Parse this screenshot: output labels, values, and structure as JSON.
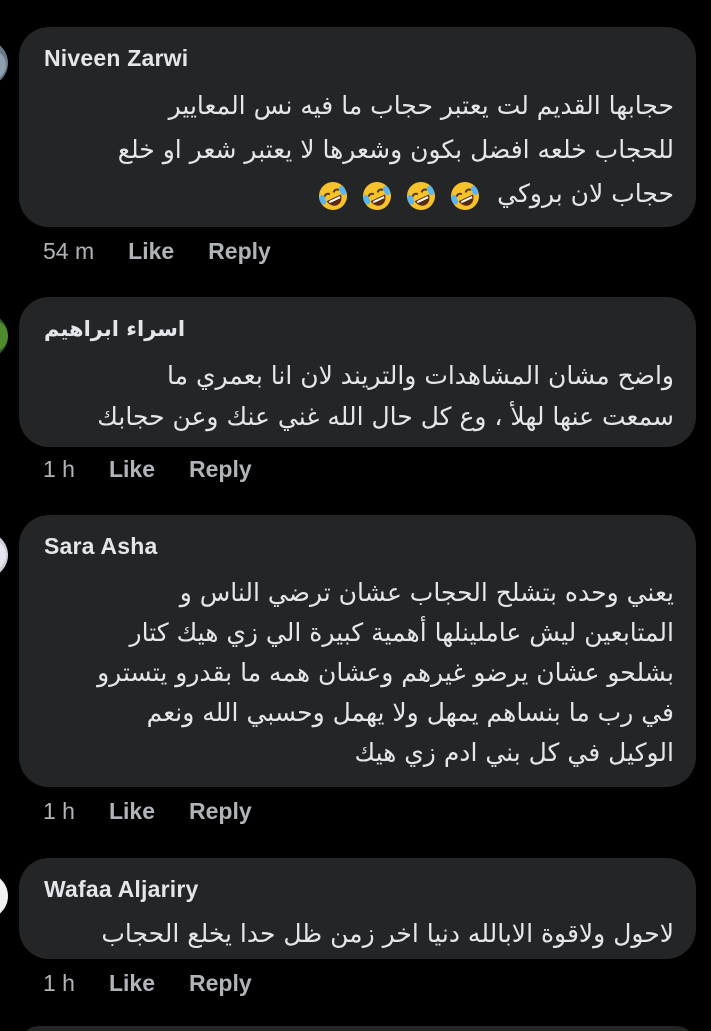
{
  "colors": {
    "background": "#000000",
    "bubble": "#242526",
    "primary_text": "#e4e6eb",
    "secondary_text": "#b0b3b8"
  },
  "comments": [
    {
      "author": "Niveen Zarwi",
      "lines": [
        "حجابها القديم لت يعتبر حجاب ما فيه نس المعايير",
        "للحجاب خلعه افضل بكون وشعرها لا يعتبر شعر او خلع",
        "حجاب لان بروكي"
      ],
      "emoji": "🤣🤣🤣🤣",
      "emoji_icon": "rolling-on-floor-laughing-icon",
      "time": "54 m",
      "like": "Like",
      "reply": "Reply"
    },
    {
      "author": "اسراء ابراهيم",
      "lines": [
        "واضح مشان المشاهدات والتريند لان انا بعمري ما",
        "سمعت عنها لهلأ ، وع كل حال الله غني عنك وعن حجابك"
      ],
      "time": "1 h",
      "like": "Like",
      "reply": "Reply"
    },
    {
      "author": "Sara Asha",
      "lines": [
        "يعني وحده بتشلح الحجاب عشان ترضي الناس و",
        "المتابعين ليش عاملينلها أهمية كبيرة الي زي هيك كتار",
        "بشلحو عشان يرضو غيرهم وعشان همه ما بقدرو يتسترو",
        "في رب ما بنساهم يمهل ولا يهمل وحسبي الله ونعم",
        "الوكيل في كل بني ادم زي هيك"
      ],
      "time": "1 h",
      "like": "Like",
      "reply": "Reply"
    },
    {
      "author": "Wafaa Aljariry",
      "lines": [
        "لاحول ولاقوة الابالله دنيا اخر زمن ظل حدا يخلع الحجاب"
      ],
      "time": "1 h",
      "like": "Like",
      "reply": "Reply"
    }
  ]
}
